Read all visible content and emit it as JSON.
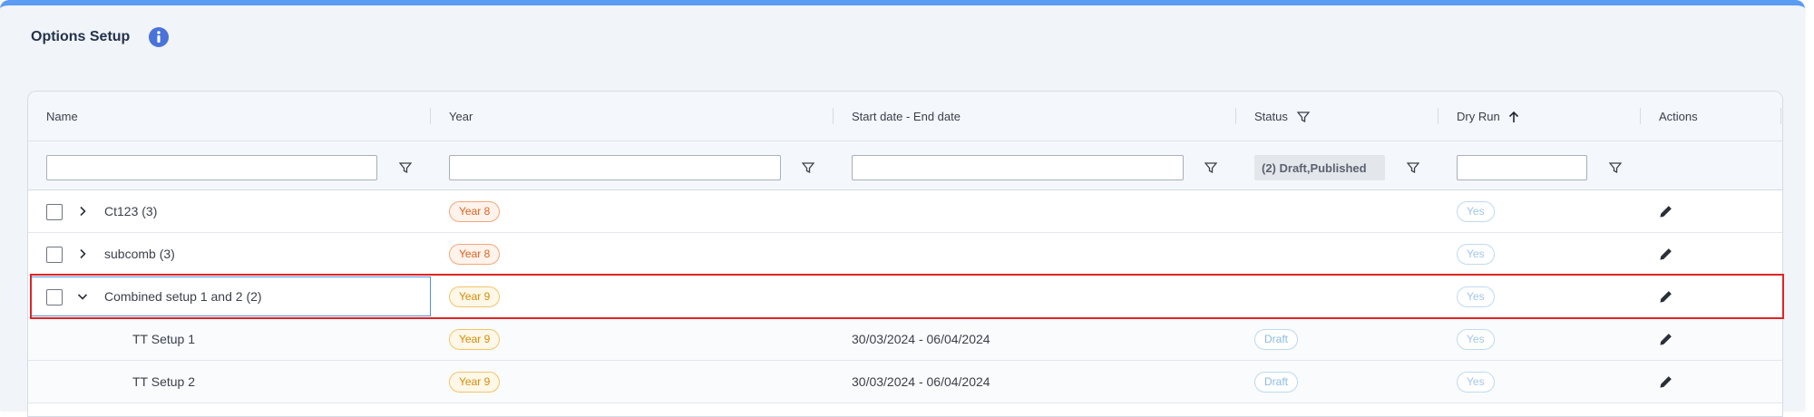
{
  "panel": {
    "title": "Options Setup",
    "accent_color": "#5b9bf2",
    "info_icon": "info-icon"
  },
  "columns": [
    {
      "key": "name",
      "label": "Name"
    },
    {
      "key": "year",
      "label": "Year"
    },
    {
      "key": "dates",
      "label": "Start date - End date"
    },
    {
      "key": "status",
      "label": "Status"
    },
    {
      "key": "dryrun",
      "label": "Dry Run"
    },
    {
      "key": "actions",
      "label": "Actions"
    }
  ],
  "filters": {
    "name": "",
    "year": "",
    "dates": "",
    "status": "(2) Draft,Published",
    "dryrun": ""
  },
  "rows": [
    {
      "name": "Ct123 (3)",
      "year": "Year 8",
      "dates": "",
      "status": "",
      "dryrun": "Yes",
      "expanded": false
    },
    {
      "name": "subcomb (3)",
      "year": "Year 8",
      "dates": "",
      "status": "",
      "dryrun": "Yes",
      "expanded": false
    },
    {
      "name": "Combined setup 1 and 2 (2)",
      "year": "Year 9",
      "dates": "",
      "status": "",
      "dryrun": "Yes",
      "expanded": true
    },
    {
      "name": "TT Setup 1",
      "year": "Year 9",
      "dates": "30/03/2024 - 06/04/2024",
      "status": "Draft",
      "dryrun": "Yes",
      "child": true
    },
    {
      "name": "TT Setup 2",
      "year": "Year 9",
      "dates": "30/03/2024 - 06/04/2024",
      "status": "Draft",
      "dryrun": "Yes",
      "child": true
    }
  ]
}
